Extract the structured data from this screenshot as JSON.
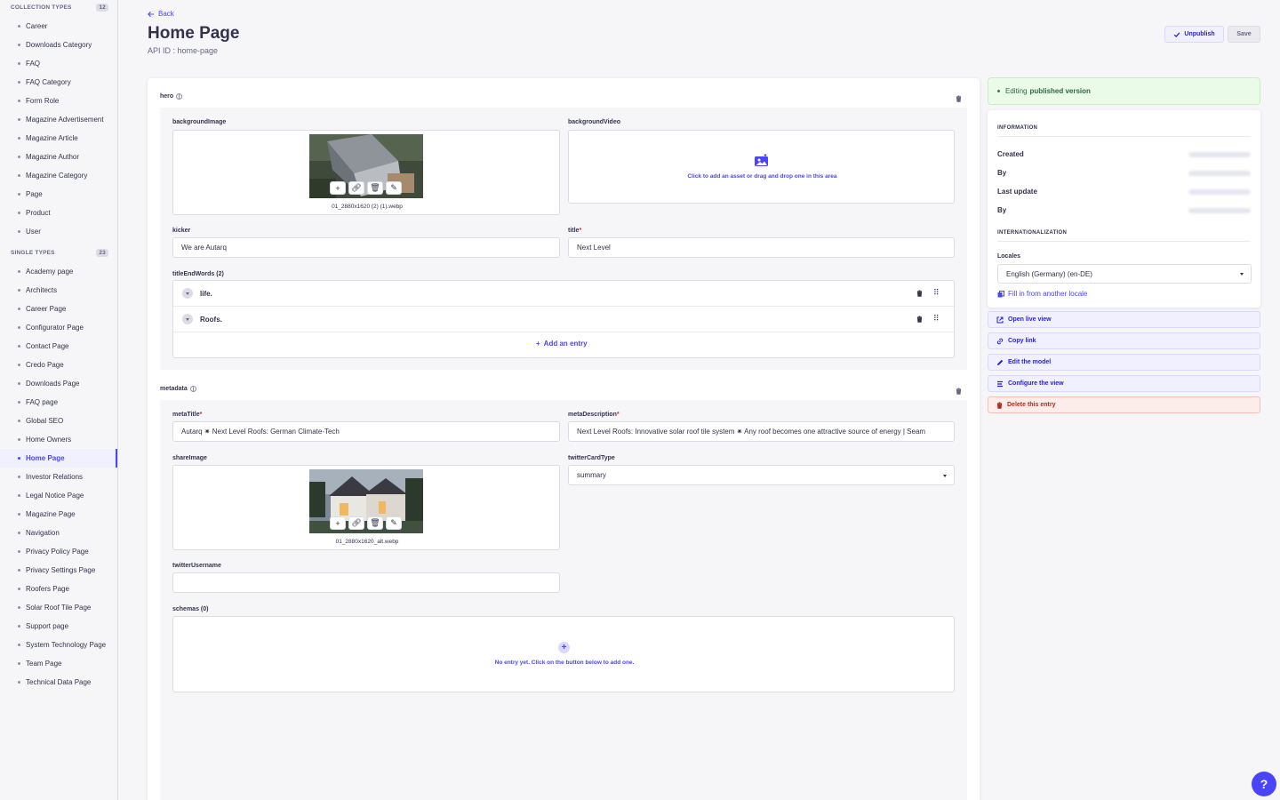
{
  "sidebar": {
    "collection_types": {
      "title": "COLLECTION TYPES",
      "count": "12",
      "items": [
        "Career",
        "Downloads Category",
        "FAQ",
        "FAQ Category",
        "Form Role",
        "Magazine Advertisement",
        "Magazine Article",
        "Magazine Author",
        "Magazine Category",
        "Page",
        "Product",
        "User"
      ]
    },
    "single_types": {
      "title": "SINGLE TYPES",
      "count": "23",
      "items": [
        "Academy page",
        "Architects",
        "Career Page",
        "Configurator Page",
        "Contact Page",
        "Credo Page",
        "Downloads Page",
        "FAQ page",
        "Global SEO",
        "Home Owners",
        "Home Page",
        "Investor Relations",
        "Legal Notice Page",
        "Magazine Page",
        "Navigation",
        "Privacy Policy Page",
        "Privacy Settings Page",
        "Roofers Page",
        "Solar Roof Tile Page",
        "Support page",
        "System Technology Page",
        "Team Page",
        "Technical Data Page"
      ],
      "active": "Home Page"
    }
  },
  "header": {
    "back": "Back",
    "title": "Home Page",
    "api_id": "API ID : home-page",
    "unpublish": "Unpublish",
    "save": "Save"
  },
  "hero": {
    "label": "hero",
    "background_image_label": "backgroundImage",
    "background_image_name": "01_2880x1620 (2) (1).webp",
    "background_video_label": "backgroundVideo",
    "background_video_empty": "Click to add an asset or drag and drop one in this area",
    "kicker_label": "kicker",
    "kicker_value": "We are Autarq",
    "title_label": "title",
    "title_value": "Next Level",
    "title_end_words_label": "titleEndWords (2)",
    "title_end_words": [
      "life.",
      "Roofs."
    ],
    "add_entry": "Add an entry"
  },
  "metadata": {
    "label": "metadata",
    "meta_title_label": "metaTitle",
    "meta_title_value": "Autarq ✷ Next Level Roofs: German Climate-Tech",
    "meta_description_label": "metaDescription",
    "meta_description_value": "Next Level Roofs: Innovative solar roof tile system ✷ Any roof becomes one attractive source of energy | Seam",
    "share_image_label": "shareImage",
    "share_image_name": "01_2880x1620_alt.webp",
    "twitter_card_type_label": "twitterCardType",
    "twitter_card_type_value": "summary",
    "twitter_username_label": "twitterUsername",
    "twitter_username_value": "",
    "schemas_label": "schemas (0)",
    "schemas_empty": "No entry yet. Click on the button below to add one."
  },
  "status": {
    "prefix": "Editing",
    "emphasis": "published version"
  },
  "information": {
    "heading": "INFORMATION",
    "created_label": "Created",
    "by_label": "By",
    "last_update_label": "Last update",
    "by2_label": "By",
    "i18n_heading": "INTERNATIONALIZATION",
    "locales_label": "Locales",
    "locale_value": "English (Germany) (en-DE)",
    "fill_locale": "Fill in from another locale"
  },
  "actions": {
    "open_live_view": "Open live view",
    "copy_link": "Copy link",
    "edit_model": "Edit the model",
    "configure_view": "Configure the view",
    "delete_entry": "Delete this entry"
  },
  "help": "?",
  "colors": {
    "primary": "#4945ff",
    "danger": "#d02b20",
    "success": "#328048",
    "text": "#32324d",
    "muted": "#666687"
  }
}
